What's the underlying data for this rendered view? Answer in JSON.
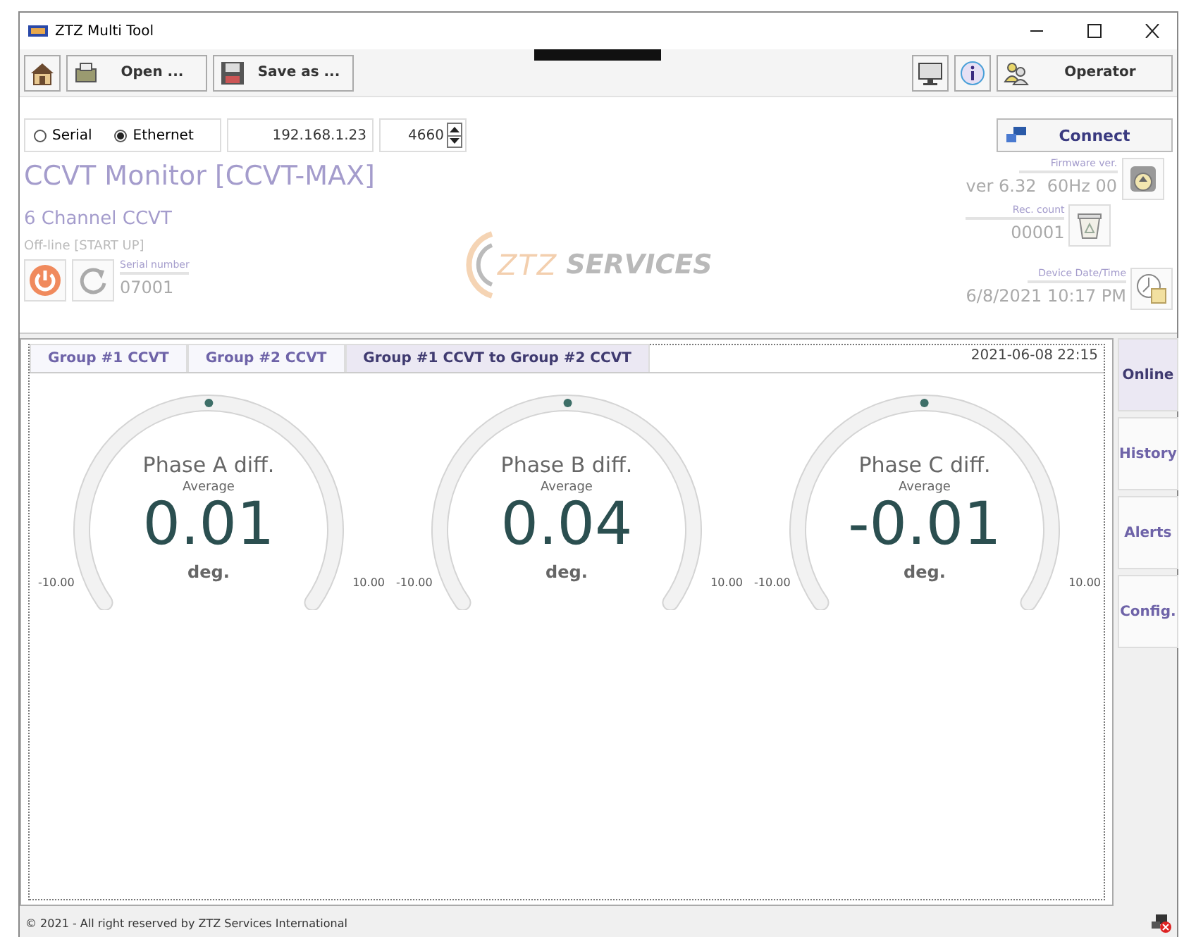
{
  "window": {
    "title": "ZTZ Multi Tool"
  },
  "toolbar": {
    "open": "Open ...",
    "save": "Save as ...",
    "user": "Operator"
  },
  "connection": {
    "modes": [
      {
        "label": "Serial",
        "selected": false
      },
      {
        "label": "Ethernet",
        "selected": true
      }
    ],
    "address": "192.168.1.23",
    "port": "4660",
    "connect": "Connect"
  },
  "device": {
    "title": "CCVT Monitor [CCVT-MAX]",
    "subtitle": "6 Channel CCVT",
    "status": "Off-line [START UP]",
    "serial_label": "Serial number",
    "serial": "07001",
    "firmware_label": "Firmware ver.",
    "firmware": "ver 6.32  60Hz 00",
    "rec_label": "Rec. count",
    "rec": "00001",
    "datetime_label": "Device Date/Time",
    "datetime": "6/8/2021 10:17 PM"
  },
  "logo": {
    "mark": "ZTZ",
    "word": "SERVICES"
  },
  "tabs": [
    {
      "label": "Group #1 CCVT",
      "selected": false
    },
    {
      "label": "Group #2 CCVT",
      "selected": false
    },
    {
      "label": "Group #1 CCVT to Group #2 CCVT",
      "selected": true
    }
  ],
  "timestamp": "2021-06-08 22:15",
  "gauges": [
    {
      "title": "Phase A diff.",
      "subtitle": "Average",
      "value": "0.01",
      "unit": "deg.",
      "min": "-10.00",
      "max": "10.00",
      "level": 0.5005
    },
    {
      "title": "Phase B diff.",
      "subtitle": "Average",
      "value": "0.04",
      "unit": "deg.",
      "min": "-10.00",
      "max": "10.00",
      "level": 0.502
    },
    {
      "title": "Phase C diff.",
      "subtitle": "Average",
      "value": "-0.01",
      "unit": "deg.",
      "min": "-10.00",
      "max": "10.00",
      "level": 0.4995
    }
  ],
  "side_tabs": [
    {
      "label": "Online",
      "selected": true
    },
    {
      "label": "History",
      "selected": false
    },
    {
      "label": "Alerts",
      "selected": false
    },
    {
      "label": "Config.",
      "selected": false
    }
  ],
  "status_bar": {
    "text": "© 2021 - All right reserved by ZTZ Services International"
  }
}
